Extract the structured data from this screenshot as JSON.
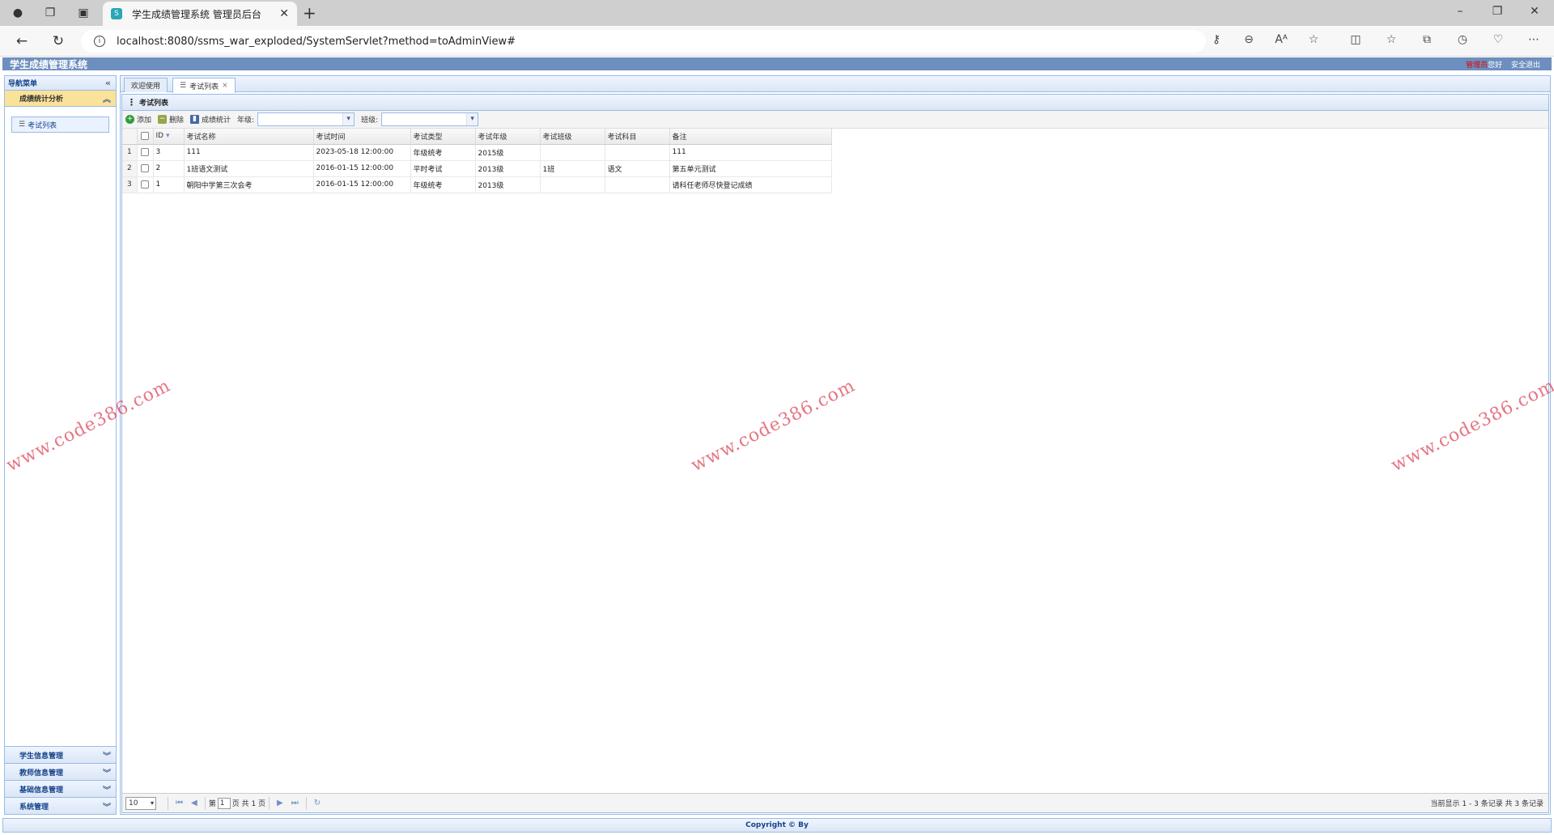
{
  "browser": {
    "tab_title": "学生成绩管理系统 管理员后台",
    "url": "localhost:8080/ssms_war_exploded/SystemServlet?method=toAdminView#"
  },
  "app": {
    "title": "学生成绩管理系统",
    "role": "管理员",
    "greeting": "您好",
    "logout": "安全退出",
    "footer": "Copyright © By"
  },
  "sidebar": {
    "header": "导航菜单",
    "active_group": "成绩统计分析",
    "active_item": "考试列表",
    "collapsed_groups": [
      "学生信息管理",
      "教师信息管理",
      "基础信息管理",
      "系统管理"
    ]
  },
  "tabs": [
    {
      "label": "欢迎使用"
    },
    {
      "label": "考试列表"
    }
  ],
  "grid": {
    "title": "考试列表",
    "toolbar": {
      "add": "添加",
      "delete": "删除",
      "stats": "成绩统计",
      "grade_label": "年级:",
      "class_label": "班级:"
    },
    "columns": [
      "ID",
      "考试名称",
      "考试时间",
      "考试类型",
      "考试年级",
      "考试班级",
      "考试科目",
      "备注"
    ],
    "rows": [
      {
        "no": "1",
        "id": "3",
        "name": "111",
        "time": "2023-05-18 12:00:00",
        "type": "年级统考",
        "grade": "2015级",
        "clazz": "",
        "subject": "",
        "remark": "111"
      },
      {
        "no": "2",
        "id": "2",
        "name": "1班语文测试",
        "time": "2016-01-15 12:00:00",
        "type": "平时考试",
        "grade": "2013级",
        "clazz": "1班",
        "subject": "语文",
        "remark": "第五单元测试"
      },
      {
        "no": "3",
        "id": "1",
        "name": "朝阳中学第三次会考",
        "time": "2016-01-15 12:00:00",
        "type": "年级统考",
        "grade": "2013级",
        "clazz": "",
        "subject": "",
        "remark": "请科任老师尽快登记成绩"
      }
    ],
    "pager": {
      "page_size": "10",
      "page_prefix": "第",
      "page_value": "1",
      "page_suffix": "页 共 1 页",
      "info": "当前显示 1 - 3 条记录 共 3 条记录"
    }
  },
  "watermark": "www.code386.com"
}
